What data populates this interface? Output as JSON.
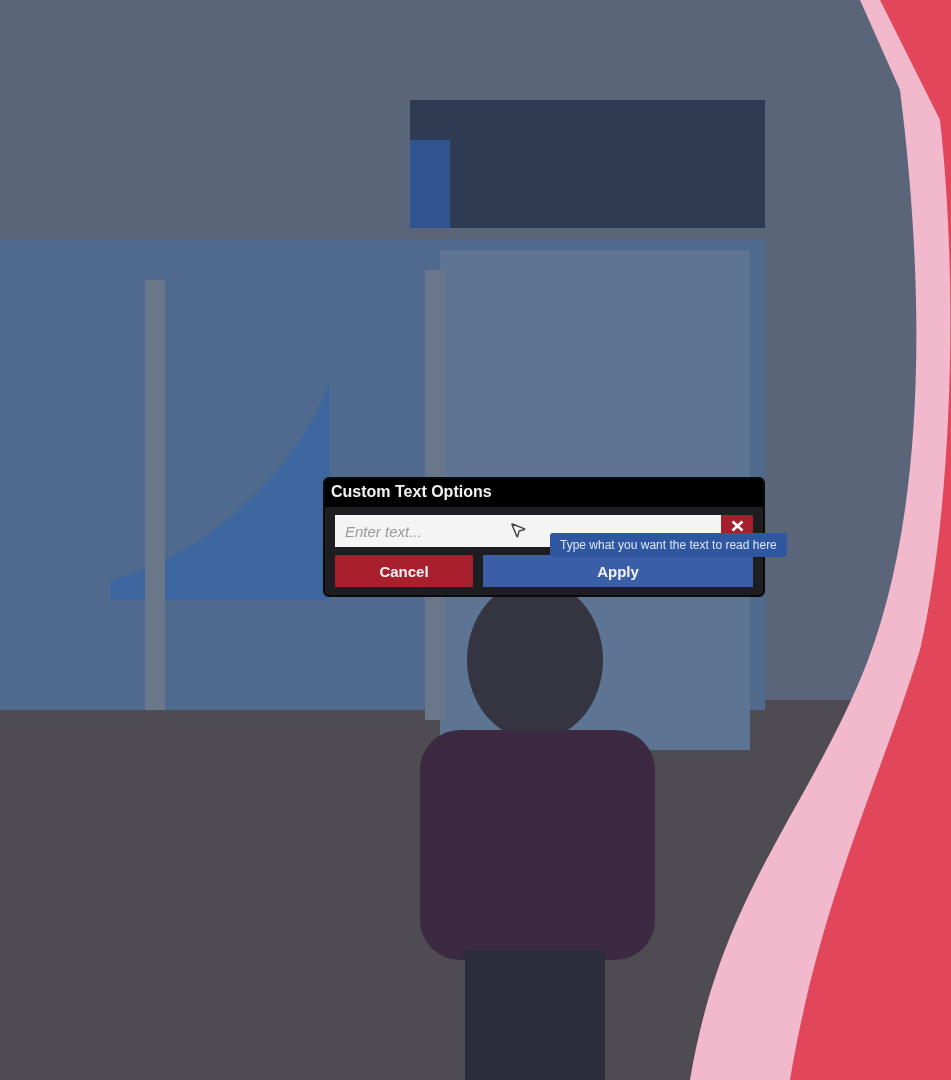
{
  "dialog": {
    "title": "Custom Text Options",
    "field": {
      "placeholder": "Enter text..."
    },
    "tooltip": "Type what you want the text to read here",
    "buttons": [
      {
        "kind": "cancel",
        "label": "Cancel"
      },
      {
        "kind": "apply",
        "label": "Apply"
      }
    ]
  }
}
